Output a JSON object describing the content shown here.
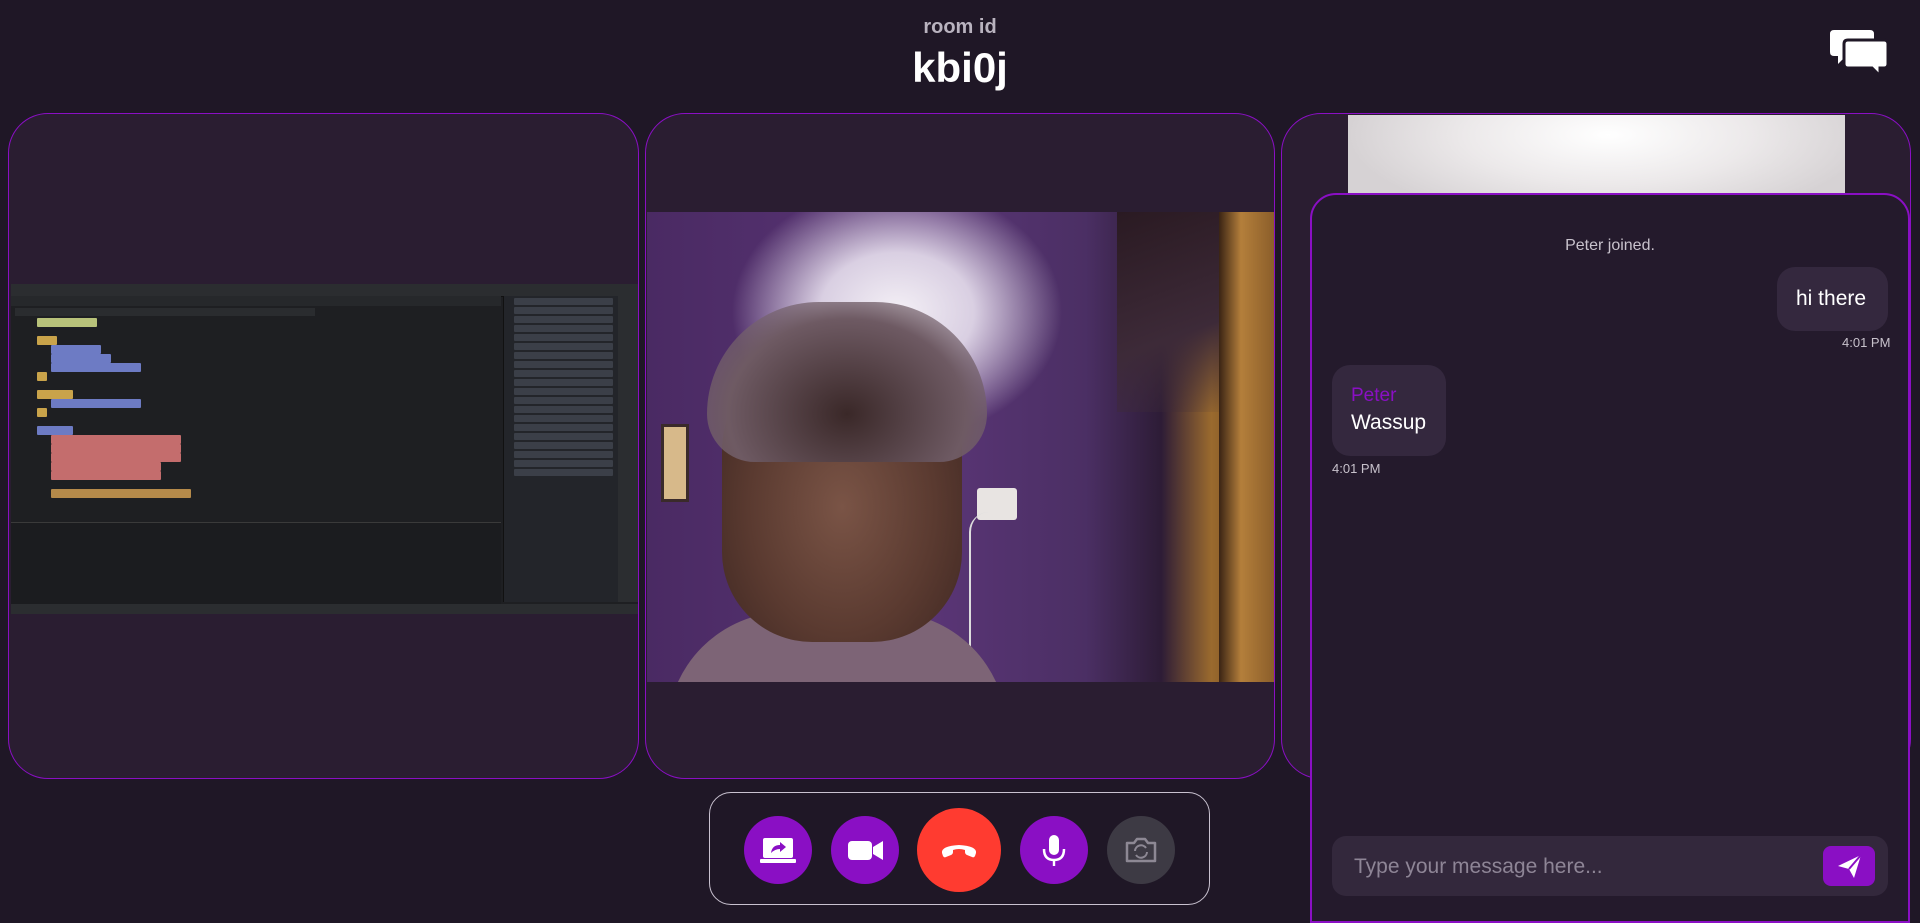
{
  "header": {
    "room_label": "room id",
    "room_id": "kbi0j"
  },
  "chat": {
    "system_message": "Peter joined.",
    "messages": [
      {
        "direction": "outgoing",
        "text": "hi there",
        "time": "4:01 PM"
      },
      {
        "direction": "incoming",
        "sender": "Peter",
        "text": "Wassup",
        "time": "4:01 PM"
      }
    ],
    "input_placeholder": "Type your message here..."
  },
  "controls": {
    "share_screen": "share-screen-icon",
    "video": "video-camera-icon",
    "end_call": "phone-hangup-icon",
    "mic": "microphone-icon",
    "switch_camera": "camera-switch-icon"
  },
  "colors": {
    "background": "#1f1726",
    "accent": "#8a0fc4",
    "end_call": "#ff3b30",
    "tile_border": "#8a0fc4"
  }
}
